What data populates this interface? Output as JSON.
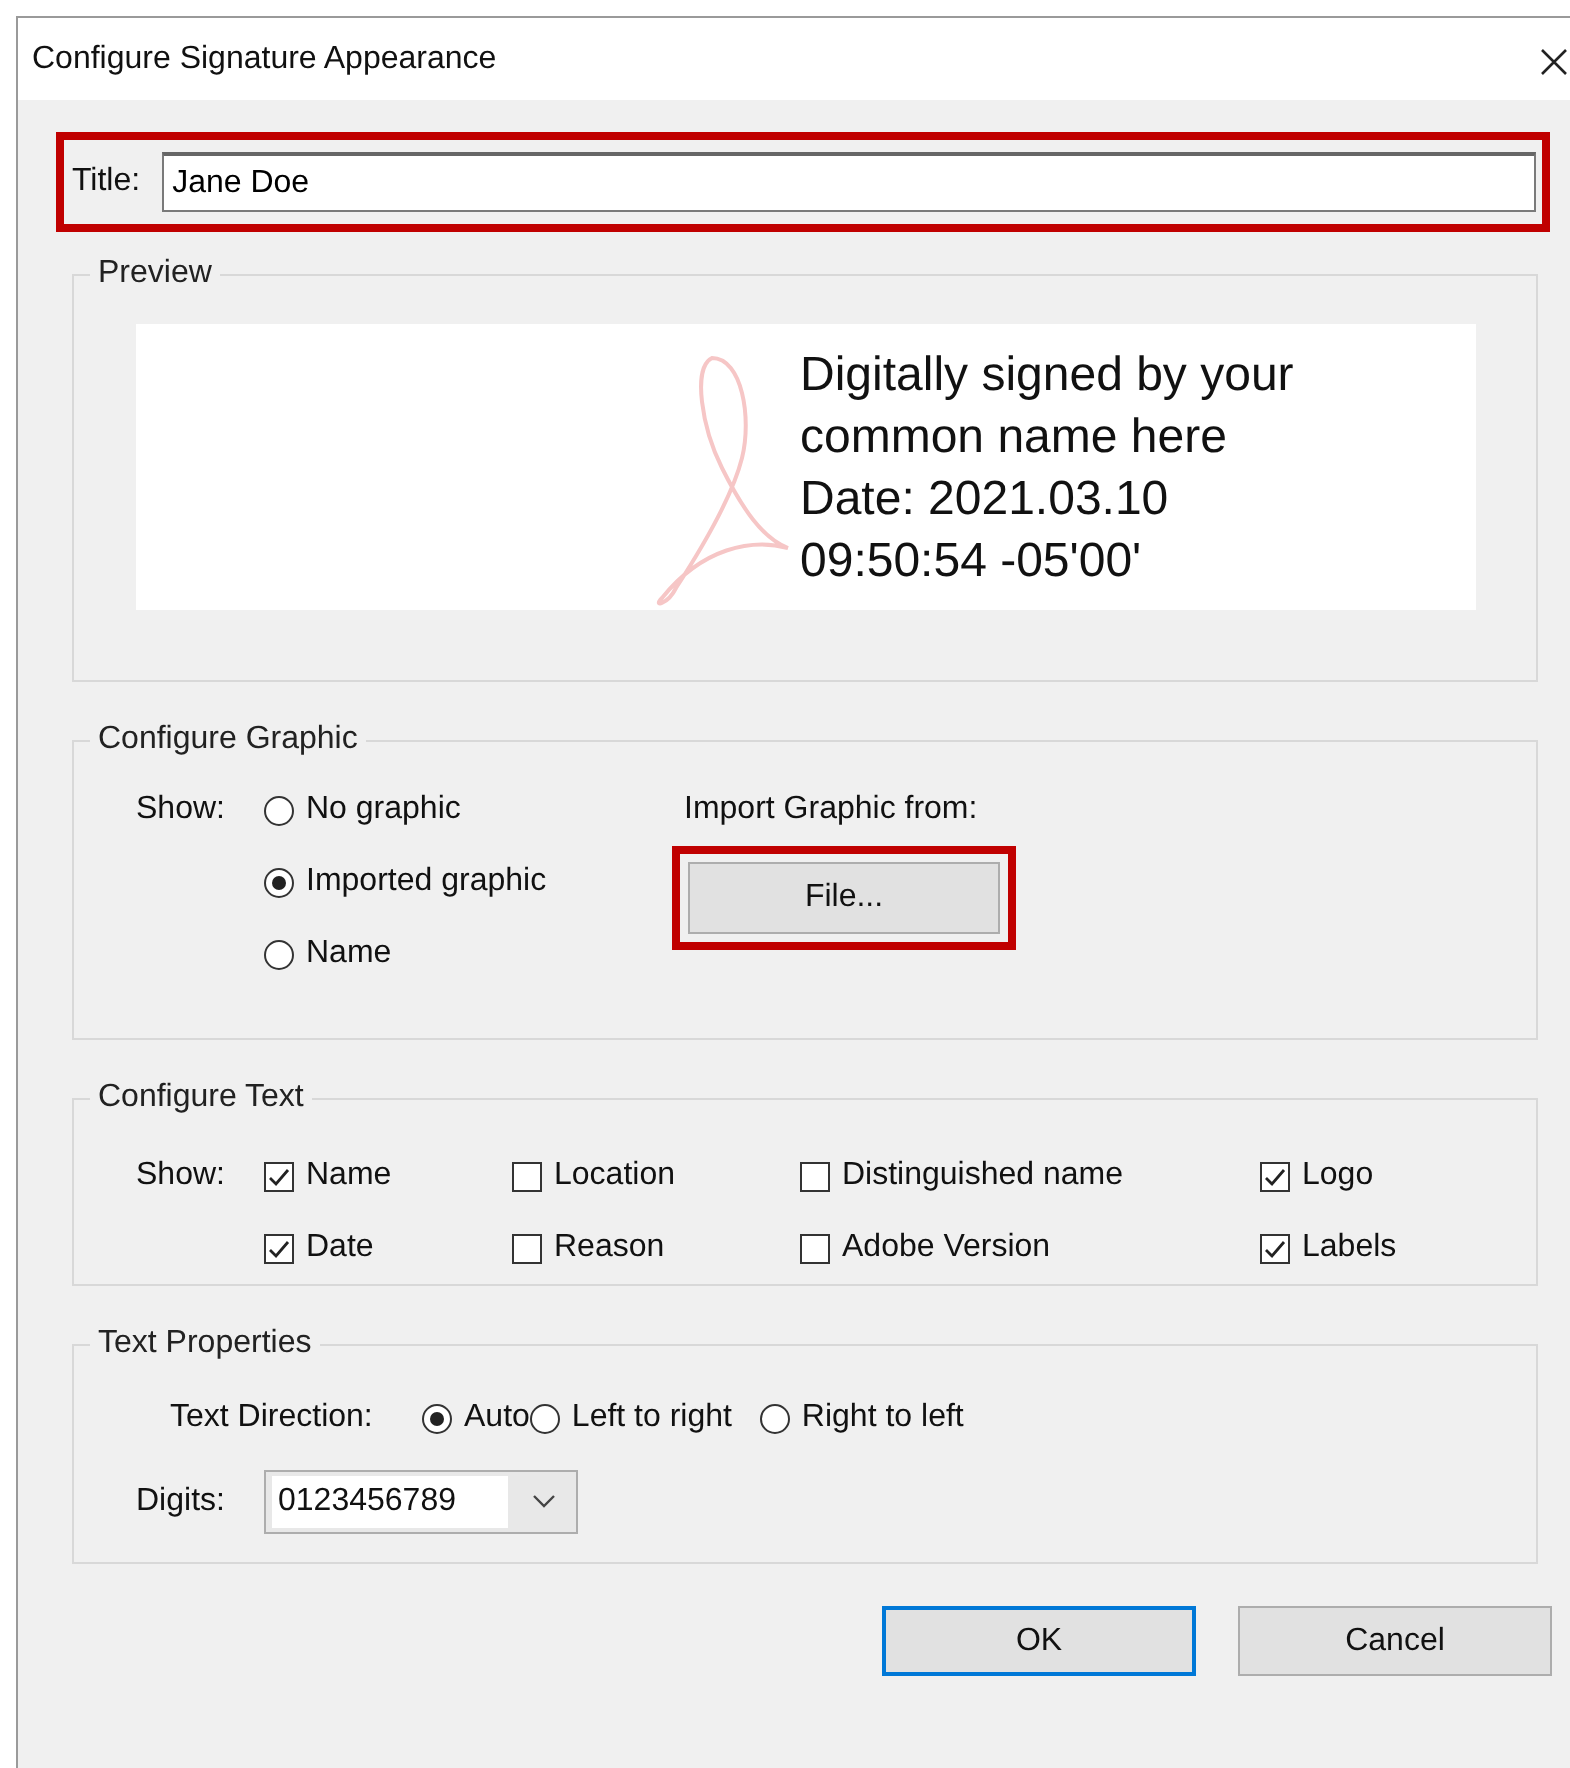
{
  "window": {
    "title": "Configure Signature Appearance"
  },
  "title_field": {
    "label": "Title:",
    "value": "Jane Doe",
    "highlighted": true
  },
  "preview": {
    "legend": "Preview",
    "lines": [
      "Digitally signed by your",
      "common name here",
      "Date: 2021.03.10",
      "09:50:54 -05'00'"
    ]
  },
  "configure_graphic": {
    "legend": "Configure Graphic",
    "show_label": "Show:",
    "options": [
      {
        "label": "No graphic",
        "selected": false
      },
      {
        "label": "Imported graphic",
        "selected": true
      },
      {
        "label": "Name",
        "selected": false
      }
    ],
    "import_label": "Import Graphic from:",
    "file_button": {
      "label": "File...",
      "highlighted": true
    }
  },
  "configure_text": {
    "legend": "Configure Text",
    "show_label": "Show:",
    "options": [
      {
        "label": "Name",
        "checked": true
      },
      {
        "label": "Location",
        "checked": false
      },
      {
        "label": "Distinguished name",
        "checked": false
      },
      {
        "label": "Logo",
        "checked": true
      },
      {
        "label": "Date",
        "checked": true
      },
      {
        "label": "Reason",
        "checked": false
      },
      {
        "label": "Adobe Version",
        "checked": false
      },
      {
        "label": "Labels",
        "checked": true
      }
    ]
  },
  "text_properties": {
    "legend": "Text Properties",
    "direction_label": "Text Direction:",
    "directions": [
      {
        "label": "Auto",
        "selected": true
      },
      {
        "label": "Left to right",
        "selected": false
      },
      {
        "label": "Right to left",
        "selected": false
      }
    ],
    "digits_label": "Digits:",
    "digits_value": "0123456789"
  },
  "buttons": [
    {
      "label": "OK",
      "default": true
    },
    {
      "label": "Cancel",
      "default": false
    }
  ]
}
